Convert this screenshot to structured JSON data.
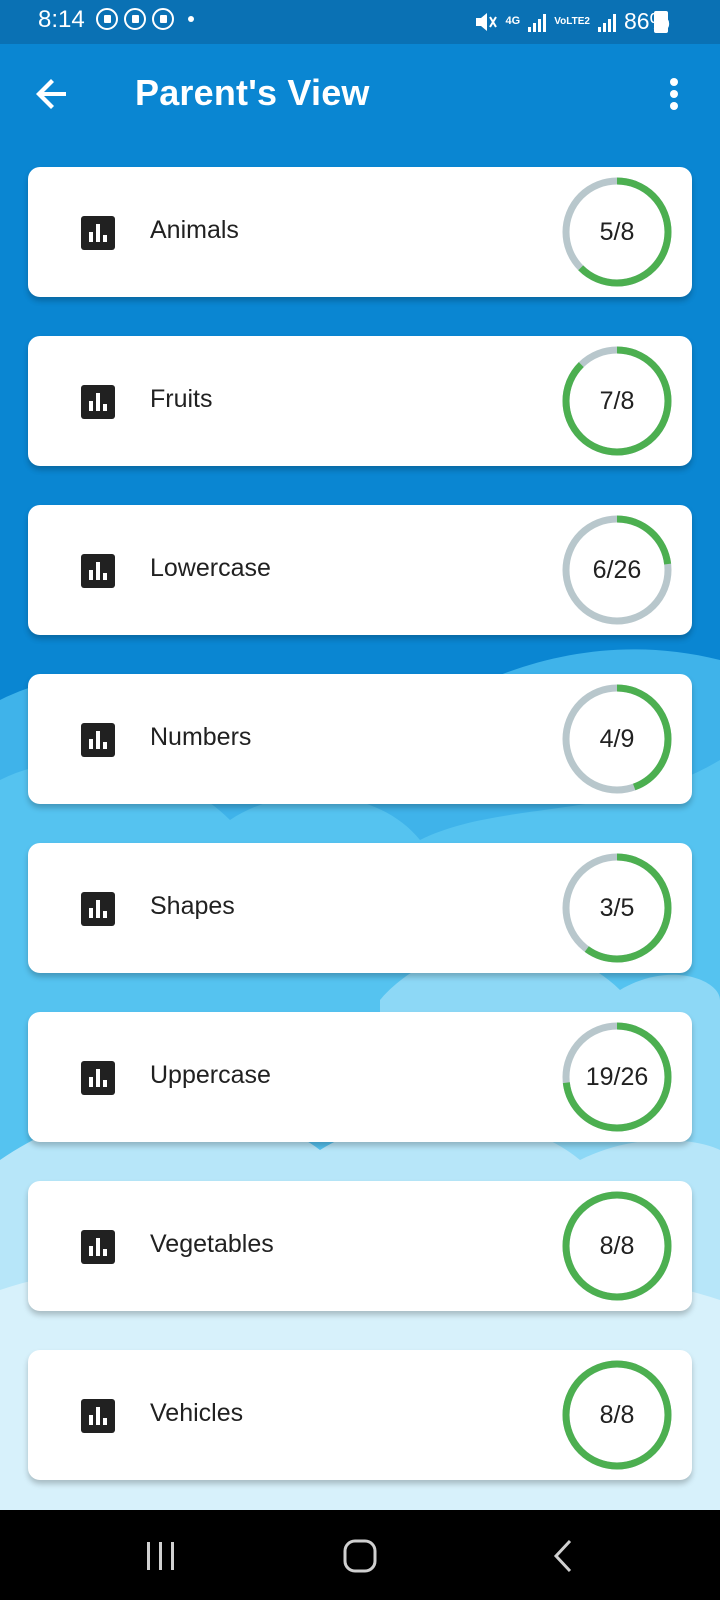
{
  "status_bar": {
    "time": "8:14",
    "battery": "86%",
    "network_label": "4G",
    "lte_label": "VoLTE2"
  },
  "app_bar": {
    "title": "Parent's View",
    "back_icon": "arrow-back-icon",
    "menu_icon": "more-vert-icon"
  },
  "colors": {
    "primary": "#0a86d2",
    "progress_fill": "#4caf50",
    "progress_track": "#b8c7cc",
    "card": "#ffffff"
  },
  "categories": [
    {
      "label": "Animals",
      "completed": 5,
      "total": 8,
      "progress_text": "5/8"
    },
    {
      "label": "Fruits",
      "completed": 7,
      "total": 8,
      "progress_text": "7/8"
    },
    {
      "label": "Lowercase",
      "completed": 6,
      "total": 26,
      "progress_text": "6/26"
    },
    {
      "label": "Numbers",
      "completed": 4,
      "total": 9,
      "progress_text": "4/9"
    },
    {
      "label": "Shapes",
      "completed": 3,
      "total": 5,
      "progress_text": "3/5"
    },
    {
      "label": "Uppercase",
      "completed": 19,
      "total": 26,
      "progress_text": "19/26"
    },
    {
      "label": "Vegetables",
      "completed": 8,
      "total": 8,
      "progress_text": "8/8"
    },
    {
      "label": "Vehicles",
      "completed": 8,
      "total": 8,
      "progress_text": "8/8"
    }
  ],
  "nav_bar": {
    "recent_icon": "recent-apps-icon",
    "home_icon": "home-icon",
    "back_icon": "nav-back-icon"
  }
}
